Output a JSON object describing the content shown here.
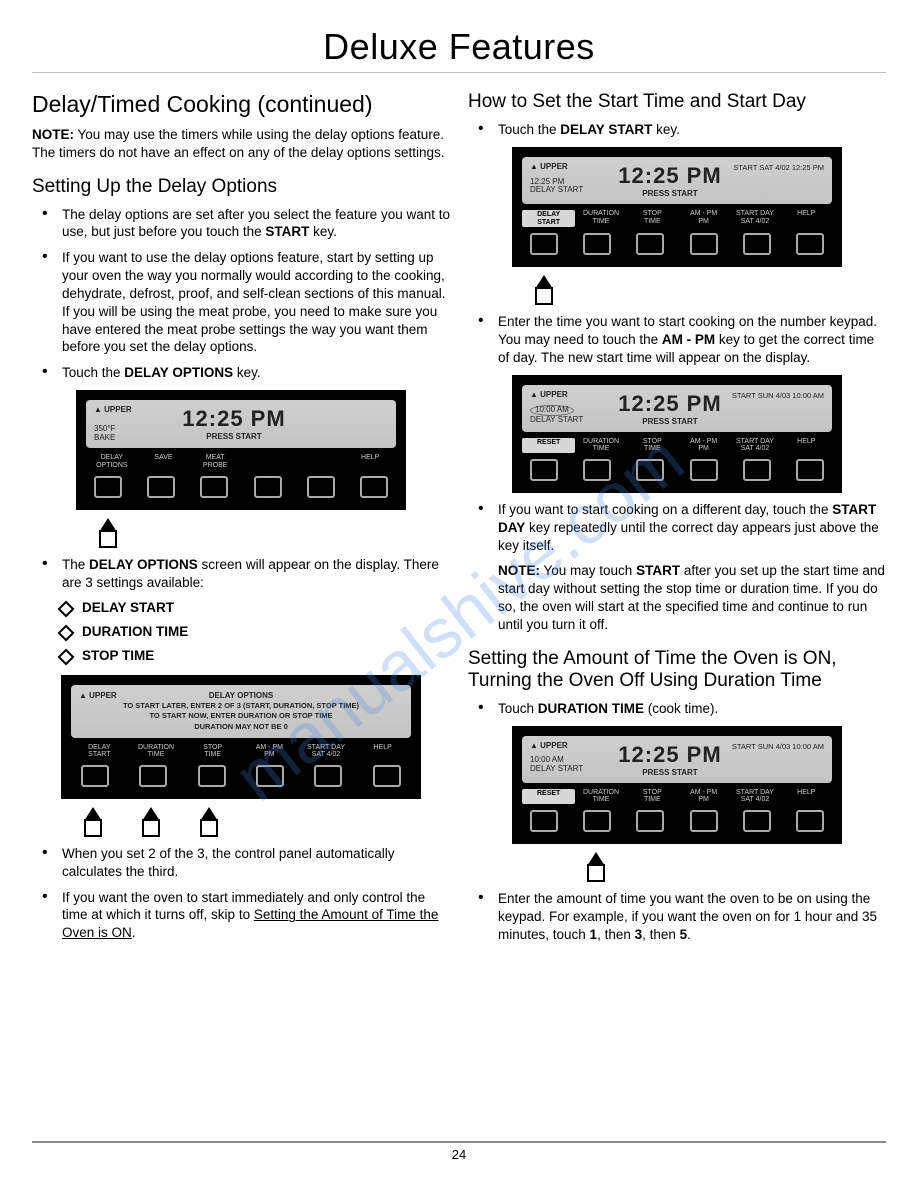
{
  "page": {
    "title": "Deluxe Features",
    "number": "24"
  },
  "watermark": "manualshive.com",
  "left": {
    "h2": "Delay/Timed Cooking (continued)",
    "note_label": "NOTE:",
    "note_text": " You may use the timers while using the delay options feature. The timers do not have an effect on any of the delay options settings.",
    "h3a": "Setting Up the Delay Options",
    "b1": "The delay options are set after you select the feature you want to use, but just before you touch the ",
    "b1_bold": "START",
    "b1_tail": " key.",
    "b2": "If you want to use the delay options feature, start by setting up your oven the way you normally would according to the cooking, dehydrate, defrost, proof, and self-clean sections of this manual. If you will be using the meat probe, you need to make sure you have entered the meat probe settings the way you want them before you set the delay options.",
    "b3_pre": "Touch the ",
    "b3_bold": "DELAY OPTIONS",
    "b3_post": " key.",
    "b4_pre": "The ",
    "b4_bold": "DELAY OPTIONS",
    "b4_post": " screen will appear on the display. There are 3 settings available:",
    "d1": "DELAY START",
    "d2": "DURATION TIME",
    "d3": "STOP TIME",
    "b5": "When you set 2 of the 3, the control panel automatically calculates the third.",
    "b6_pre": "If you want the oven to start immediately and only control the time at which it turns off, skip to ",
    "b6_link": "Setting the Amount of Time the Oven is ON",
    "b6_post": "."
  },
  "right": {
    "h3a": "How to Set the Start Time and Start Day",
    "b1_pre": "Touch the ",
    "b1_bold": "DELAY START",
    "b1_post": " key.",
    "b2_pre": "Enter the time you want to start cooking on the number keypad. You may need to touch the ",
    "b2_bold": "AM - PM",
    "b2_post": " key to get the correct time of day. The new start time will appear on the display.",
    "b3_pre": "If you want to start cooking on a different day, touch the ",
    "b3_bold": "START DAY",
    "b3_post": " key repeatedly until the correct day appears just above the key itself.",
    "note2_label": "NOTE:",
    "note2_pre": " You may touch ",
    "note2_bold": "START",
    "note2_post": " after you set up the start time and start day without setting the stop time or duration time. If you do so, the oven will start at the specified time and continue to run until you turn it off.",
    "h3b": "Setting the Amount of Time the Oven is ON, Turning the Oven Off Using Duration Time",
    "b4_pre": "Touch ",
    "b4_bold": "DURATION TIME",
    "b4_post": " (cook time).",
    "b5_pre": "Enter the amount of time you want the oven to be on using the keypad. For example, if you want the oven on for 1 hour and 35 minutes, touch ",
    "b5_b1": "1",
    "b5_mid": ", then ",
    "b5_b2": "3",
    "b5_mid2": ", then ",
    "b5_b3": "5",
    "b5_post": "."
  },
  "panel_common": {
    "upper": "▲ UPPER",
    "clock": "12:25 PM",
    "press": "PRESS START",
    "help": "HELP"
  },
  "panelA": {
    "left1": "350°F",
    "left2": "BAKE",
    "lab1a": "DELAY",
    "lab1b": "OPTIONS",
    "lab2": "SAVE",
    "lab3a": "MEAT",
    "lab3b": "PROBE"
  },
  "panelB": {
    "title": "DELAY OPTIONS",
    "msg1": "TO START LATER, ENTER 2 OF 3 (START, DURATION, STOP TIME)",
    "msg2": "TO START NOW, ENTER DURATION OR STOP TIME",
    "msg3": "DURATION MAY NOT BE 0",
    "lab1a": "DELAY",
    "lab1b": "START",
    "lab2a": "DURATION",
    "lab2b": "TIME",
    "lab3a": "STOP",
    "lab3b": "TIME",
    "lab4a": "AM - PM",
    "lab4b": "PM",
    "lab5a": "START DAY",
    "lab5b": "SAT 4/02"
  },
  "panelC": {
    "left1": "12:25 PM",
    "left2": "DELAY START",
    "right": "START SAT 4/02 12:25 PM",
    "hl1a": "DELAY",
    "hl1b": "START",
    "lab2a": "DURATION",
    "lab2b": "TIME",
    "lab3a": "STOP",
    "lab3b": "TIME",
    "lab4a": "AM - PM",
    "lab4b": "PM",
    "lab5a": "START DAY",
    "lab5b": "SAT 4/02"
  },
  "panelD": {
    "left1": "10:00 AM",
    "left2": "DELAY START",
    "right": "START SUN 4/03 10:00 AM",
    "hl": "RESET",
    "lab2a": "DURATION",
    "lab2b": "TIME",
    "lab3a": "STOP",
    "lab3b": "TIME",
    "lab4a": "AM - PM",
    "lab4b": "PM",
    "lab5a": "START DAY",
    "lab5b": "SAT 4/02"
  },
  "panelE": {
    "left1": "10:00 AM",
    "left2": "DELAY START",
    "right": "START SUN 4/03 10:00 AM",
    "hl": "RESET",
    "lab2a": "DURATION",
    "lab2b": "TIME",
    "lab3a": "STOP",
    "lab3b": "TIME",
    "lab4a": "AM - PM",
    "lab4b": "PM",
    "lab5a": "START DAY",
    "lab5b": "SAT 4/02"
  }
}
